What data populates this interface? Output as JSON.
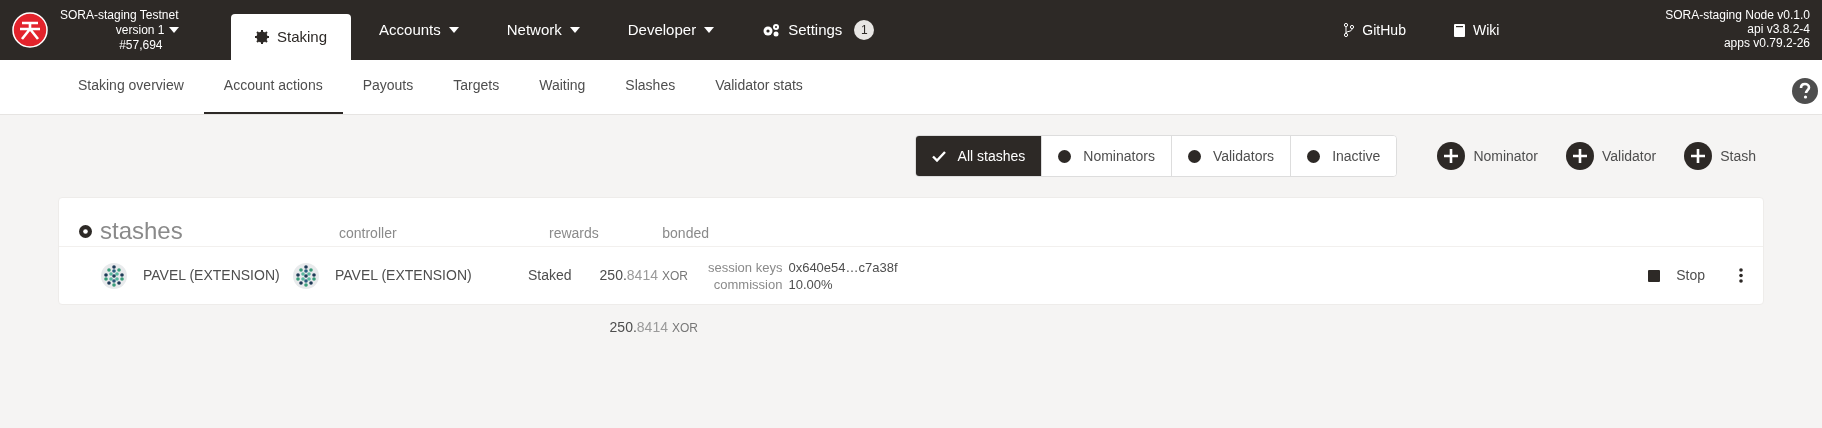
{
  "chain": {
    "name": "SORA-staging Testnet",
    "version": "version 1",
    "block": "#57,694"
  },
  "nav": [
    {
      "kind": "tab",
      "label": "Staking",
      "selected": true
    },
    {
      "kind": "menu",
      "label": "Accounts",
      "selected": false
    },
    {
      "kind": "menu",
      "label": "Network",
      "selected": false
    },
    {
      "kind": "menu",
      "label": "Developer",
      "selected": false
    },
    {
      "kind": "settings",
      "label": "Settings",
      "badge": "1",
      "selected": false
    }
  ],
  "links": [
    {
      "kind": "github",
      "label": "GitHub"
    },
    {
      "kind": "wiki",
      "label": "Wiki"
    }
  ],
  "node_info": [
    "SORA-staging Node v0.1.0",
    "api v3.8.2-4",
    "apps v0.79.2-26"
  ],
  "subtabs": [
    {
      "label": "Staking overview",
      "selected": false
    },
    {
      "label": "Account actions",
      "selected": true
    },
    {
      "label": "Payouts",
      "selected": false
    },
    {
      "label": "Targets",
      "selected": false
    },
    {
      "label": "Waiting",
      "selected": false
    },
    {
      "label": "Slashes",
      "selected": false
    },
    {
      "label": "Validator stats",
      "selected": false
    }
  ],
  "filters": [
    {
      "label": "All stashes",
      "selected": true
    },
    {
      "label": "Nominators",
      "selected": false
    },
    {
      "label": "Validators",
      "selected": false
    },
    {
      "label": "Inactive",
      "selected": false
    }
  ],
  "add_buttons": [
    "Nominator",
    "Validator",
    "Stash"
  ],
  "table": {
    "title": "stashes",
    "columns": [
      "controller",
      "rewards",
      "bonded"
    ],
    "rows": [
      {
        "stash": "PAVEL (EXTENSION)",
        "controller": "PAVEL (EXTENSION)",
        "rewards": "Staked",
        "bonded": {
          "whole": "250.",
          "fraction": "8414",
          "unit": "XOR"
        },
        "details": [
          {
            "label": "session keys",
            "value": "0x640e54…c7a38f"
          },
          {
            "label": "commission",
            "value": "10.00%"
          }
        ],
        "action": "Stop"
      }
    ],
    "total": {
      "whole": "250.",
      "fraction": "8414",
      "unit": "XOR"
    }
  }
}
